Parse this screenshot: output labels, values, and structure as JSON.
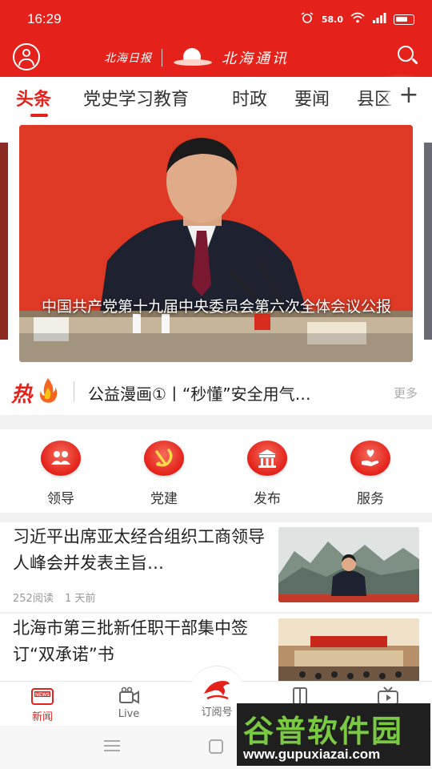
{
  "status_bar": {
    "time": "16:29",
    "indicators": [
      "alarm-icon",
      "data-speed-icon",
      "wifi-icon",
      "signal-icon",
      "battery-icon"
    ],
    "data_speed": "58.0"
  },
  "header": {
    "paper_name": "北海日报",
    "app_title": "北海通讯",
    "accent_color": "#e4211a"
  },
  "tabs": {
    "items": [
      "头条",
      "党史学习教育",
      "时政",
      "要闻",
      "县区"
    ],
    "active": "头条",
    "add_icon": "plus-icon"
  },
  "carousel": {
    "caption": "中国共产党第十九届中央委员会第六次全体会议公报"
  },
  "hot": {
    "logo_text": "热",
    "headline": "公益漫画①丨“秒懂”安全用气…",
    "more_label": "更多"
  },
  "quick_nav": [
    {
      "label": "领导",
      "icon": "people-icon"
    },
    {
      "label": "党建",
      "icon": "party-emblem-icon"
    },
    {
      "label": "发布",
      "icon": "building-icon"
    },
    {
      "label": "服务",
      "icon": "heart-hand-icon"
    }
  ],
  "news": [
    {
      "title": "习近平出席亚太经合组织工商领导人峰会并发表主旨…",
      "reads": "252阅读",
      "time": "1 天前"
    },
    {
      "title": "北海市第三批新任职干部集中签订“双承诺”书",
      "reads": "",
      "time": ""
    }
  ],
  "bottom_nav": [
    {
      "label": "新闻",
      "icon": "news-icon",
      "active": true
    },
    {
      "label": "Live",
      "icon": "video-icon",
      "active": false
    },
    {
      "label": "订阅号",
      "icon": "dolphin-icon",
      "active": false
    },
    {
      "label": "",
      "icon": "book-icon",
      "active": false
    },
    {
      "label": "",
      "icon": "tv-icon",
      "active": false
    }
  ],
  "watermark": {
    "name": "谷普软件园",
    "url": "www.gupuxiazai.com"
  }
}
